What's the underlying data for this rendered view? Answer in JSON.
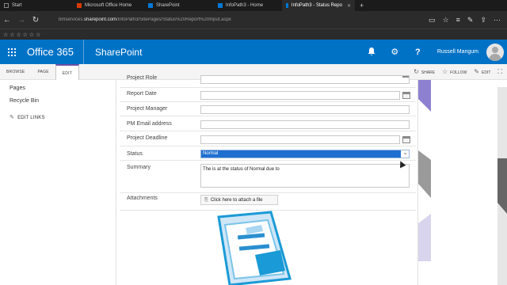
{
  "browser": {
    "tabs": [
      {
        "label": "Start",
        "active": false
      },
      {
        "label": "Microsoft Office Home",
        "active": false
      },
      {
        "label": "SharePoint",
        "active": false
      },
      {
        "label": "InfoPath3 - Home",
        "active": false
      },
      {
        "label": "InfoPath3 - Status Repo",
        "active": true
      }
    ],
    "url_prefix": "bmservices.",
    "url_domain": "sharepoint.com",
    "url_path": "/InfoPath3/SitePages/Status%20Report%20Input.aspx",
    "favorite_stars": "☆ ☆ ☆ ☆ ☆ ☆"
  },
  "suite": {
    "brand": "Office 365",
    "app": "SharePoint",
    "user_name": "Russell Mangum"
  },
  "ribbon": {
    "tabs": [
      "BROWSE",
      "PAGE",
      "EDIT"
    ],
    "actions": [
      "SHARE",
      "FOLLOW",
      "EDIT"
    ]
  },
  "leftnav": {
    "items": [
      "Pages",
      "Recycle Bin"
    ],
    "edit_links": "EDIT LINKS"
  },
  "form": {
    "fields": {
      "project_role": "Project Role",
      "report_date": "Report Date",
      "project_manager": "Project Manager",
      "pm_email": "PM Email address",
      "project_deadline": "Project Deadline",
      "status": "Status",
      "summary": "Summary",
      "attachments": "Attachments"
    },
    "status_value": "Normal",
    "summary_value": "The is at the status of Normal due to",
    "attach_link": "Click here to attach a file"
  },
  "colors": {
    "suite_blue": "#0072c6",
    "selection_blue": "#1f6fd1",
    "ribbon_accent": "#6d4fa8"
  }
}
